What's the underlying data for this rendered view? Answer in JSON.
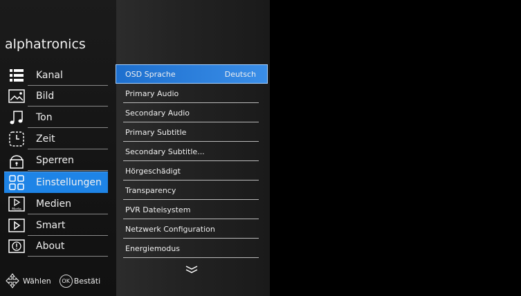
{
  "brand": "alphatronics",
  "nav": [
    {
      "label": "Kanal",
      "icon": "channel-list-icon",
      "active": false
    },
    {
      "label": "Bild",
      "icon": "picture-icon",
      "active": false
    },
    {
      "label": "Ton",
      "icon": "music-note-icon",
      "active": false
    },
    {
      "label": "Zeit",
      "icon": "clock-icon",
      "active": false
    },
    {
      "label": "Sperren",
      "icon": "lock-icon",
      "active": false
    },
    {
      "label": "Einstellungen",
      "icon": "settings-grid-icon",
      "active": true
    },
    {
      "label": "Medien",
      "icon": "media-play-icon",
      "media_caption": "Media",
      "active": false
    },
    {
      "label": "Smart",
      "icon": "smart-play-icon",
      "active": false
    },
    {
      "label": "About",
      "icon": "info-icon",
      "active": false
    }
  ],
  "menu": [
    {
      "label": "OSD Sprache",
      "value": "Deutsch",
      "selected": true
    },
    {
      "label": "Primary Audio",
      "value": ""
    },
    {
      "label": "Secondary Audio",
      "value": ""
    },
    {
      "label": "Primary Subtitle",
      "value": ""
    },
    {
      "label": "Secondary Subtitle...",
      "value": ""
    },
    {
      "label": "Hörgeschädigt",
      "value": ""
    },
    {
      "label": "Transparency",
      "value": ""
    },
    {
      "label": "PVR Dateisystem",
      "value": ""
    },
    {
      "label": "Netzwerk Configuration",
      "value": ""
    },
    {
      "label": "Energiemodus",
      "value": ""
    }
  ],
  "hints": {
    "navigate_label": "Wählen",
    "ok_key": "OK",
    "confirm_label": "Bestäti"
  },
  "colors": {
    "accent": "#1e84e6",
    "selected_row": "#2a7fe0"
  }
}
